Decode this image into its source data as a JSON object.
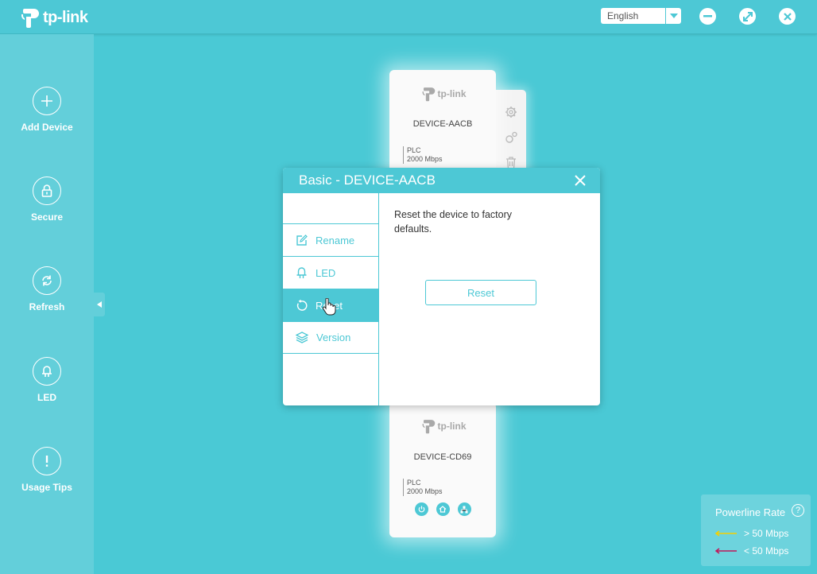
{
  "app": {
    "brand": "tp-link",
    "language": "English"
  },
  "sidebar": {
    "items": [
      {
        "label": "Add Device",
        "icon": "plus-icon"
      },
      {
        "label": "Secure",
        "icon": "lock-icon"
      },
      {
        "label": "Refresh",
        "icon": "refresh-icon"
      },
      {
        "label": "LED",
        "icon": "led-icon"
      },
      {
        "label": "Usage Tips",
        "icon": "exclamation-icon"
      }
    ]
  },
  "devices": [
    {
      "brand": "tp-link",
      "name": "DEVICE-AACB",
      "type": "PLC",
      "rate": "2000 Mbps"
    },
    {
      "brand": "tp-link",
      "name": "DEVICE-CD69",
      "type": "PLC",
      "rate": "2000 Mbps"
    }
  ],
  "dialog": {
    "title": "Basic - DEVICE-AACB",
    "menu": [
      {
        "label": "Rename",
        "icon": "edit-icon"
      },
      {
        "label": "LED",
        "icon": "led-icon"
      },
      {
        "label": "Reset",
        "icon": "reset-icon",
        "active": true
      },
      {
        "label": "Version",
        "icon": "layers-icon"
      }
    ],
    "description": "Reset the device to factory defaults.",
    "reset_label": "Reset"
  },
  "legend": {
    "title": "Powerline Rate",
    "help": "?",
    "rows": [
      {
        "label": "> 50 Mbps",
        "color": "#f5d000"
      },
      {
        "label": "< 50 Mbps",
        "color": "#c0185a"
      }
    ]
  },
  "colors": {
    "accent": "#4dc8d5",
    "background": "#4ac9d5",
    "sidebar": "#63cfda"
  }
}
